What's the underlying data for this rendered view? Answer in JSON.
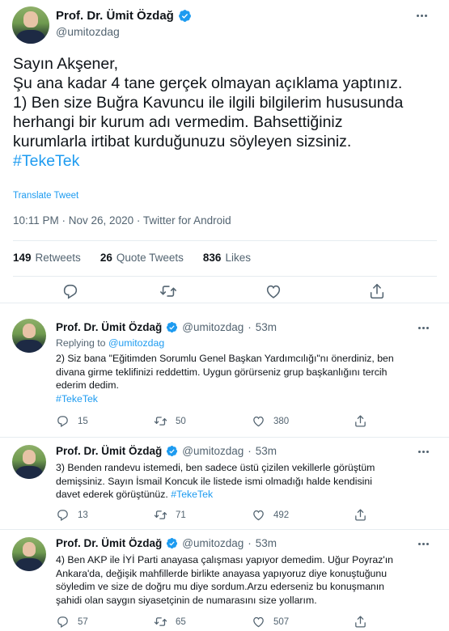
{
  "main_tweet": {
    "display_name": "Prof. Dr. Ümit Özdağ",
    "handle": "@umitozdag",
    "text_lines": [
      "Sayın Akşener,",
      "Şu ana kadar 4 tane gerçek olmayan açıklama yaptınız.",
      "1) Ben size Buğra Kavuncu ile ilgili bilgilerim hususunda",
      "herhangi bir kurum adı vermedim. Bahsettiğiniz",
      "kurumlarla irtibat kurduğunuzu söyleyen sizsiniz."
    ],
    "hashtag": "#TekeTek",
    "translate_label": "Translate Tweet",
    "meta": "10:11 PM · Nov 26, 2020 · Twitter for Android",
    "stats": {
      "retweets_count": "149",
      "retweets_label": "Retweets",
      "quotes_count": "26",
      "quotes_label": "Quote Tweets",
      "likes_count": "836",
      "likes_label": "Likes"
    }
  },
  "replies": [
    {
      "display_name": "Prof. Dr. Ümit Özdağ",
      "handle": "@umitozdag",
      "time": "53m",
      "replying_prefix": "Replying to",
      "replying_to": "@umitozdag",
      "text_lines": [
        "2) Siz bana \"Eğitimden Sorumlu Genel Başkan Yardımcılığı\"nı önerdiniz, ben",
        "divana girme teklifinizi reddettim. Uygun görürseniz grup başkanlığını tercih",
        "ederim dedim."
      ],
      "hashtag": "#TekeTek",
      "replies": "15",
      "retweets": "50",
      "likes": "380"
    },
    {
      "display_name": "Prof. Dr. Ümit Özdağ",
      "handle": "@umitozdag",
      "time": "53m",
      "text_lines": [
        "3) Benden randevu istemedi, ben sadece üstü çizilen vekillerle görüştüm",
        "demişsiniz. Sayın İsmail Koncuk ile listede ismi olmadığı halde kendisini",
        "davet ederek görüştünüz."
      ],
      "hashtag": "#TekeTek",
      "replies": "13",
      "retweets": "71",
      "likes": "492"
    },
    {
      "display_name": "Prof. Dr. Ümit Özdağ",
      "handle": "@umitozdag",
      "time": "53m",
      "text_lines": [
        "4) Ben AKP ile İYİ Parti anayasa çalışması yapıyor demedim. Uğur Poyraz'ın",
        "Ankara'da, değişik mahfillerde birlikte anayasa yapıyoruz diye konuştuğunu",
        "söyledim ve size de doğru mu diye sordum.Arzu ederseniz bu konuşmanın",
        "şahidi olan saygın siyasetçinin de numarasını size yollarım."
      ],
      "replies": "57",
      "retweets": "65",
      "likes": "507"
    }
  ],
  "colors": {
    "accent": "#1d9bf0",
    "text": "#0f1419",
    "muted": "#536471",
    "divider": "#e6ecf0"
  },
  "icons": [
    "verified-badge-icon",
    "more-dots-icon",
    "reply-icon",
    "retweet-icon",
    "like-icon",
    "share-icon"
  ]
}
